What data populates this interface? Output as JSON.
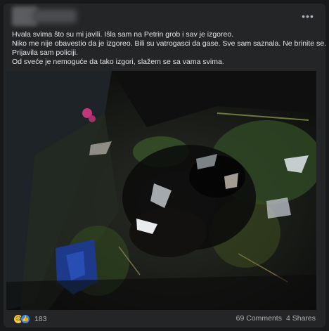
{
  "post": {
    "lines": [
      "Hvala svima što su mi javili. Išla sam na Petrin grob i sav je izgoreo.",
      "Niko me nije obavestio da je izgoreo. Bili su vatrogasci da gase. Sve sam saznala. Ne brinite se.",
      "Prijavila sam policiji.",
      "Od sveće je nemoguće da tako izgori, slažem se sa vama svima."
    ]
  },
  "header": {
    "more_label": "•••"
  },
  "photo": {
    "icon": "burned-grave-photo"
  },
  "footer": {
    "reaction_icons": [
      "sad-emoji-icon",
      "like-icon"
    ],
    "reaction_count": "183",
    "comments_label": "69 Comments",
    "shares_label": "4 Shares"
  }
}
